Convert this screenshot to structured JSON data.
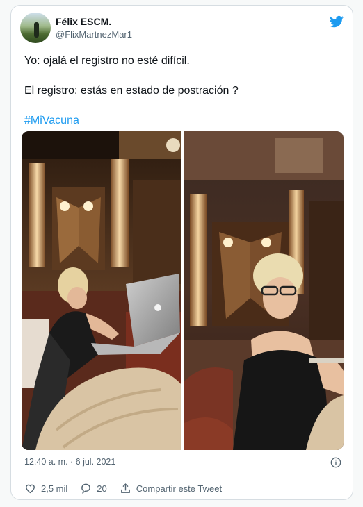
{
  "author": {
    "name": "Félix ESCM.",
    "handle": "@FlixMartnezMar1"
  },
  "tweet": {
    "line1": "Yo: ojalá el registro no esté difícil.",
    "line2": "El registro: estás en estado de postración ?",
    "hashtag": "#MiVacuna"
  },
  "timestamp": "12:40 a. m. · 6 jul. 2021",
  "actions": {
    "likes": "2,5 mil",
    "replies": "20",
    "share": "Compartir este Tweet"
  },
  "colors": {
    "accent": "#1d9bf0",
    "secondary_text": "#536471"
  },
  "icons": {
    "brand": "twitter-bird-icon",
    "info": "info-icon",
    "like": "heart-icon",
    "reply": "reply-icon",
    "share": "share-icon"
  }
}
